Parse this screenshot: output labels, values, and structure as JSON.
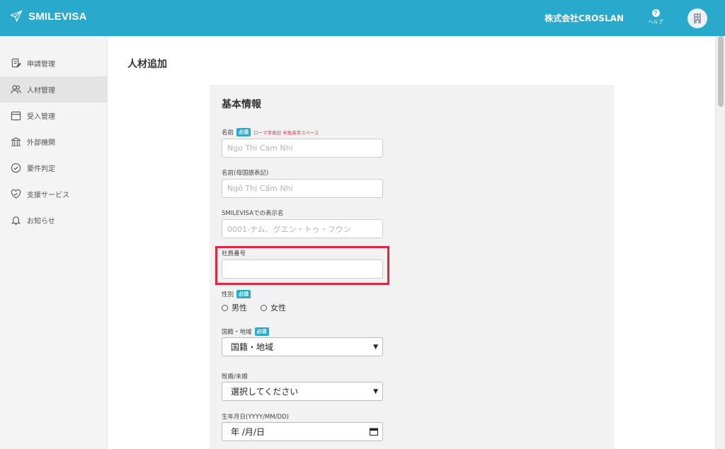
{
  "header": {
    "brand": "SMILEVISA",
    "company": "株式会社CROSLAN",
    "help_label": "ヘルプ",
    "help_symbol": "?"
  },
  "sidebar": {
    "items": [
      {
        "label": "申請管理",
        "icon": "document-edit-icon"
      },
      {
        "label": "人材管理",
        "icon": "people-icon",
        "active": true
      },
      {
        "label": "受入管理",
        "icon": "calendar-icon"
      },
      {
        "label": "外部機関",
        "icon": "building-icon"
      },
      {
        "label": "要件判定",
        "icon": "check-circle-icon"
      },
      {
        "label": "支援サービス",
        "icon": "heart-handshake-icon"
      },
      {
        "label": "お知らせ",
        "icon": "bell-icon"
      }
    ]
  },
  "page": {
    "title": "人材追加",
    "section_title": "基本情報"
  },
  "form": {
    "name": {
      "label": "名前",
      "required": "必須",
      "hint": "ローマ字表記 半角英字スペース",
      "placeholder": "Ngo Thi Cam Nhi"
    },
    "native_name": {
      "label": "名前(母国語表記)",
      "placeholder": "Ngô Thị Cẩm Nhi"
    },
    "display_name": {
      "label": "SMILEVISAでの表示名",
      "placeholder": "0001-ナム、グエン・トゥ・フウン"
    },
    "employee_number": {
      "label": "社員番号",
      "value": ""
    },
    "gender": {
      "label": "性別",
      "required": "必須",
      "options": [
        "男性",
        "女性"
      ]
    },
    "nationality": {
      "label": "国籍・地域",
      "required": "必須",
      "selected": "国籍・地域"
    },
    "marital": {
      "label": "既婚/未婚",
      "selected": "選択してください"
    },
    "birthdate": {
      "label": "生年月日(YYYY/MM/DD)",
      "value": "年 /月/日"
    }
  },
  "colors": {
    "accent": "#29a9cc",
    "highlight": "#e3263b",
    "required_badge": "#29a9cc",
    "hint": "#e0334a"
  }
}
